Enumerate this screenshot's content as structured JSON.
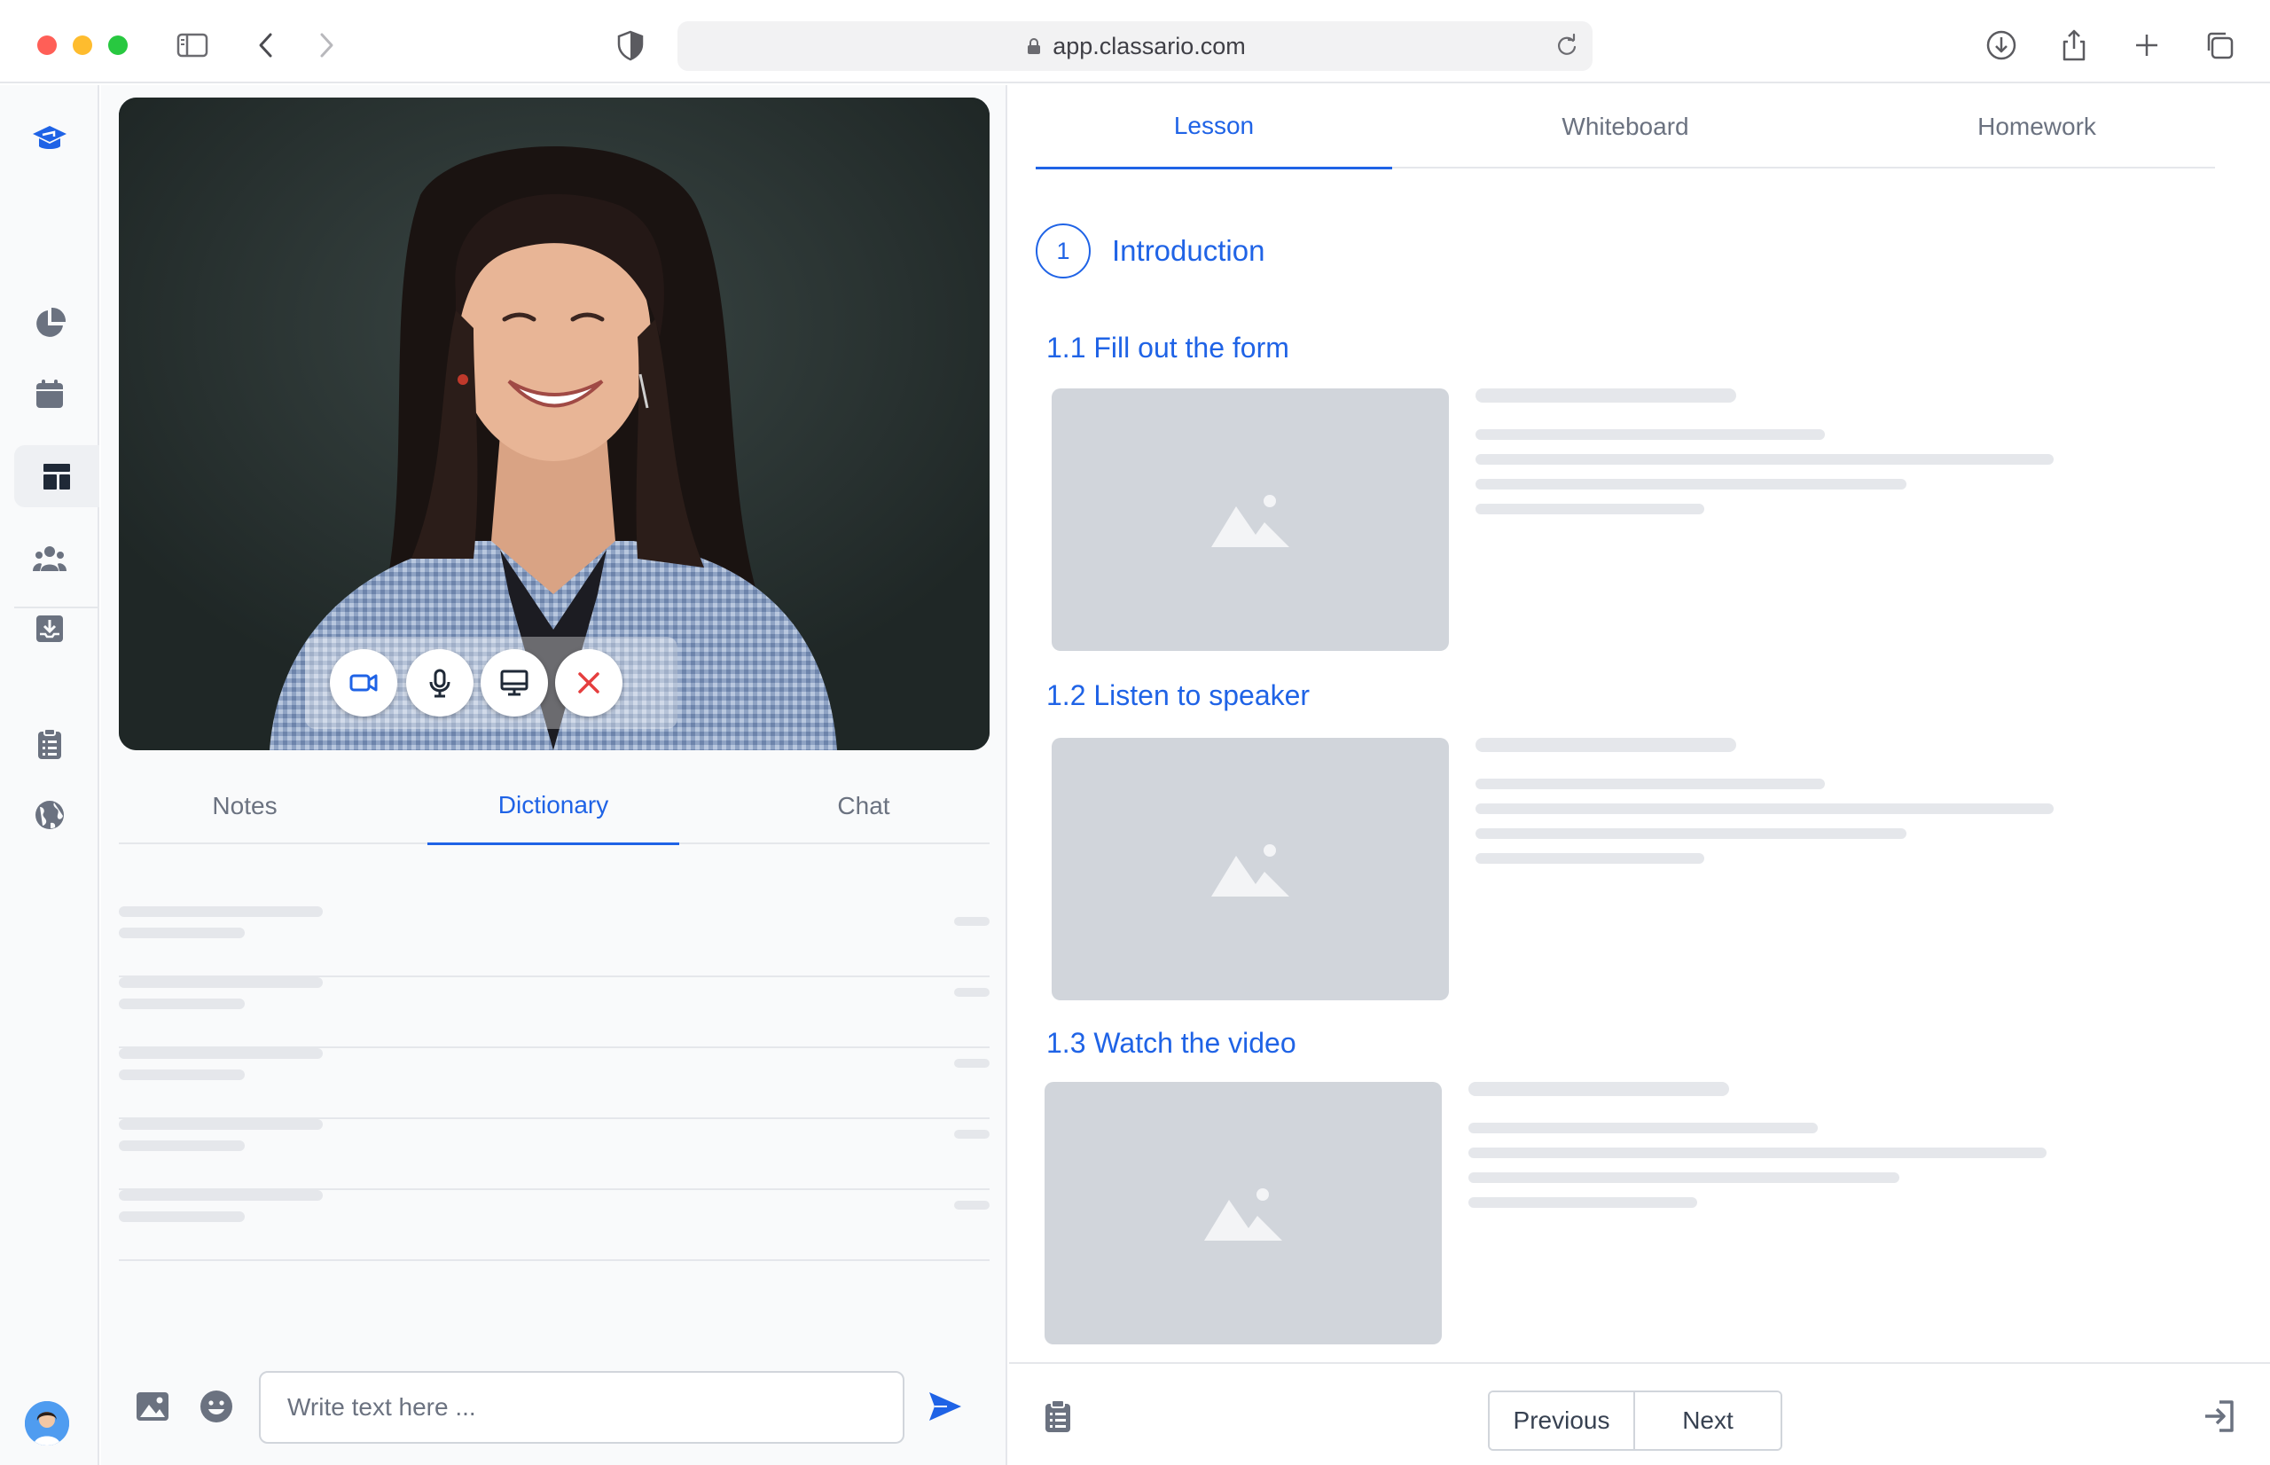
{
  "browser": {
    "url": "app.classario.com"
  },
  "sidebar": {
    "items": [
      {
        "icon": "graduation-cap-logo-icon"
      },
      {
        "icon": "pie-chart-icon"
      },
      {
        "icon": "calendar-icon"
      },
      {
        "icon": "layout-dashboard-icon"
      },
      {
        "icon": "users-group-icon"
      },
      {
        "icon": "download-tray-icon"
      },
      {
        "icon": "clipboard-list-icon"
      },
      {
        "icon": "globe-icon"
      }
    ]
  },
  "video_call": {
    "controls": [
      "video-camera",
      "microphone",
      "screen-share",
      "end-call"
    ]
  },
  "left_tabs": [
    {
      "label": "Notes"
    },
    {
      "label": "Dictionary"
    },
    {
      "label": "Chat"
    }
  ],
  "left_tabs_active": "Dictionary",
  "composer": {
    "placeholder": "Write text here ..."
  },
  "main_tabs": [
    {
      "label": "Lesson"
    },
    {
      "label": "Whiteboard"
    },
    {
      "label": "Homework"
    }
  ],
  "main_tabs_active": "Lesson",
  "lesson": {
    "section_number": "1",
    "section_title": "Introduction",
    "items": [
      {
        "title": "1.1 Fill out the form"
      },
      {
        "title": "1.2 Listen to speaker"
      },
      {
        "title": "1.3 Watch the video"
      }
    ]
  },
  "footer": {
    "previous_label": "Previous",
    "next_label": "Next"
  },
  "colors": {
    "accent": "#1f63e6",
    "end_call": "#e53e3e",
    "skeleton": "#e5e7eb",
    "thumbnail": "#d1d5db"
  }
}
